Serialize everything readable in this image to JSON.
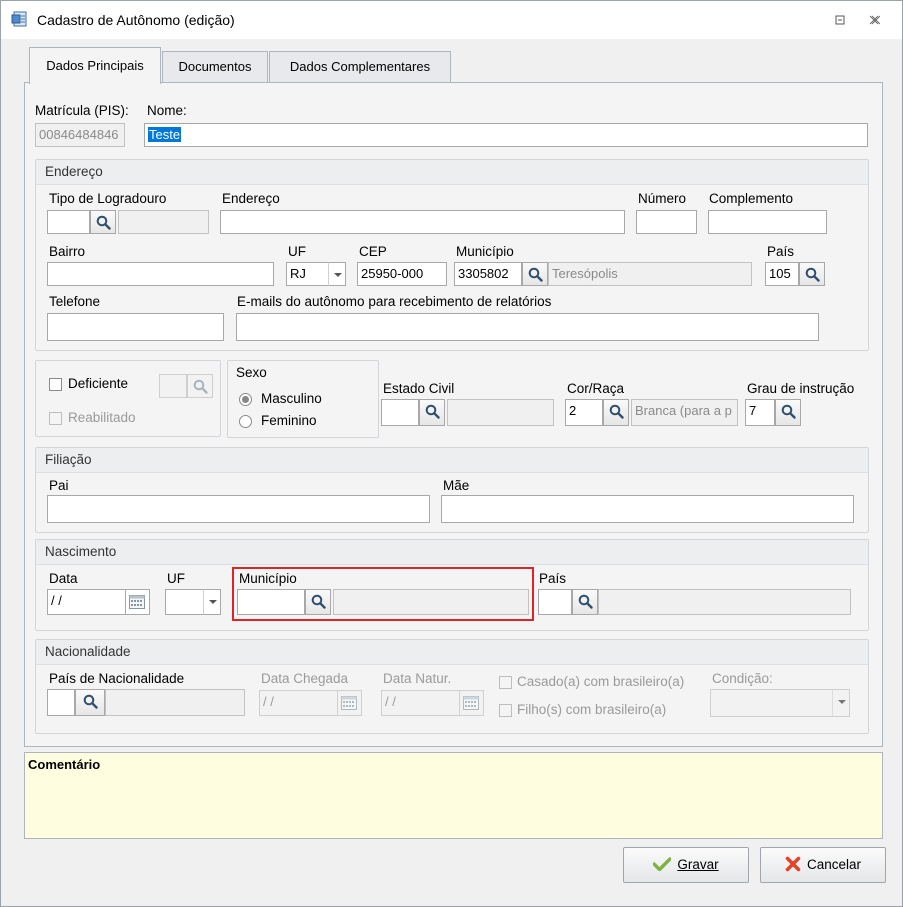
{
  "window": {
    "title": "Cadastro de Autônomo (edição)",
    "icon": "form-icon",
    "controls": [
      "restore-icon",
      "close-icon"
    ]
  },
  "tabs": [
    {
      "label": "Dados Principais",
      "active": true
    },
    {
      "label": "Documentos",
      "active": false
    },
    {
      "label": "Dados Complementares",
      "active": false
    }
  ],
  "main": {
    "matricula_label": "Matrícula (PIS):",
    "matricula_value": "00846484846",
    "nome_label": "Nome:",
    "nome_value": "Teste"
  },
  "endereco": {
    "title": "Endereço",
    "tipo_logradouro_label": "Tipo de Logradouro",
    "tipo_logradouro_value": "",
    "endereco_label": "Endereço",
    "endereco_value": "",
    "numero_label": "Número",
    "numero_value": "",
    "complemento_label": "Complemento",
    "complemento_value": "",
    "bairro_label": "Bairro",
    "bairro_value": "",
    "uf_label": "UF",
    "uf_value": "RJ",
    "cep_label": "CEP",
    "cep_value": "25950-000",
    "municipio_label": "Município",
    "municipio_code": "3305802",
    "municipio_name": "Teresópolis",
    "pais_label": "País",
    "pais_value": "105",
    "telefone_label": "Telefone",
    "telefone_value": "",
    "emails_label": "E-mails do autônomo para recebimento de relatórios",
    "emails_value": ""
  },
  "deficiente": {
    "deficiente_label": "Deficiente",
    "deficiente_checked": false,
    "reabilitado_label": "Reabilitado",
    "reabilitado_checked": false
  },
  "sexo": {
    "title": "Sexo",
    "options": [
      {
        "label": "Masculino",
        "selected": true
      },
      {
        "label": "Feminino",
        "selected": false
      }
    ]
  },
  "estado_civil": {
    "label": "Estado Civil",
    "value": "",
    "desc": ""
  },
  "cor_raca": {
    "label": "Cor/Raça",
    "value": "2",
    "desc": "Branca (para a p"
  },
  "grau_instrucao": {
    "label": "Grau de instrução",
    "value": "7"
  },
  "filiacao": {
    "title": "Filiação",
    "pai_label": "Pai",
    "pai_value": "",
    "mae_label": "Mãe",
    "mae_value": ""
  },
  "nascimento": {
    "title": "Nascimento",
    "data_label": "Data",
    "data_value": " / /",
    "uf_label": "UF",
    "uf_value": "",
    "municipio_label": "Município",
    "municipio_code": "",
    "municipio_name": "",
    "pais_label": "País",
    "pais_value": "",
    "pais_name": ""
  },
  "nacionalidade": {
    "title": "Nacionalidade",
    "pais_label": "País de Nacionalidade",
    "pais_value": "",
    "pais_name": "",
    "data_chegada_label": "Data Chegada",
    "data_chegada_value": " / /",
    "data_natur_label": "Data Natur.",
    "data_natur_value": " / /",
    "casado_label": "Casado(a) com brasileiro(a)",
    "filhos_label": "Filho(s) com brasileiro(a)",
    "condicao_label": "Condição:",
    "condicao_value": ""
  },
  "comentario": {
    "label": "Comentário",
    "value": ""
  },
  "buttons": {
    "gravar_label": "Gravar",
    "cancelar_label": "Cancelar"
  },
  "colors": {
    "accent_selection": "#0078d7",
    "highlight_border": "#e0232a",
    "comment_bg": "#fffde0"
  }
}
